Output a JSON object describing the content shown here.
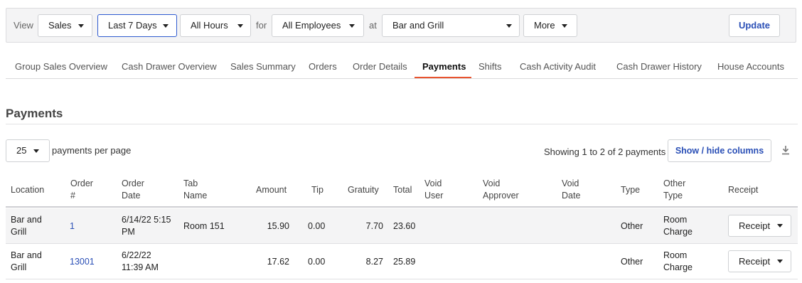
{
  "filters": {
    "view_label": "View",
    "view_value": "Sales",
    "range_value": "Last 7 Days",
    "hours_value": "All Hours",
    "for_label": "for",
    "employees_value": "All Employees",
    "at_label": "at",
    "location_value": "Bar and Grill",
    "more_label": "More",
    "update_label": "Update"
  },
  "tabs": [
    {
      "label": "Group Sales Overview"
    },
    {
      "label": "Cash Drawer Overview"
    },
    {
      "label": "Sales Summary"
    },
    {
      "label": "Orders"
    },
    {
      "label": "Order Details"
    },
    {
      "label": "Payments",
      "active": true
    },
    {
      "label": "Shifts"
    },
    {
      "label": "Cash Activity Audit"
    },
    {
      "label": "Cash Drawer History"
    },
    {
      "label": "House Accounts"
    }
  ],
  "section": {
    "title": "Payments",
    "per_page_value": "25",
    "per_page_label": "payments per page",
    "showing_text": "Showing 1 to 2 of 2 payments",
    "columns_button": "Show / hide columns",
    "download_icon": "download-icon"
  },
  "table": {
    "headers": {
      "location": "Location",
      "order_num_1": "Order",
      "order_num_2": "#",
      "order_date_1": "Order",
      "order_date_2": "Date",
      "tab_name_1": "Tab",
      "tab_name_2": "Name",
      "amount": "Amount",
      "tip": "Tip",
      "gratuity": "Gratuity",
      "total": "Total",
      "void_user_1": "Void",
      "void_user_2": "User",
      "void_approver_1": "Void",
      "void_approver_2": "Approver",
      "void_date_1": "Void",
      "void_date_2": "Date",
      "type": "Type",
      "other_type_1": "Other",
      "other_type_2": "Type",
      "receipt": "Receipt"
    },
    "rows": [
      {
        "location_1": "Bar and",
        "location_2": "Grill",
        "order_num": "1",
        "order_date_1": "6/14/22 5:15",
        "order_date_2": "PM",
        "tab_name": "Room 151",
        "amount": "15.90",
        "tip": "0.00",
        "gratuity": "7.70",
        "total": "23.60",
        "type": "Other",
        "other_type_1": "Room",
        "other_type_2": "Charge",
        "receipt_label": "Receipt"
      },
      {
        "location_1": "Bar and",
        "location_2": "Grill",
        "order_num": "13001",
        "order_date_1": "6/22/22",
        "order_date_2": "11:39 AM",
        "tab_name": "",
        "amount": "17.62",
        "tip": "0.00",
        "gratuity": "8.27",
        "total": "25.89",
        "type": "Other",
        "other_type_1": "Room",
        "other_type_2": "Charge",
        "receipt_label": "Receipt"
      }
    ]
  },
  "colors": {
    "accent": "#e8542f",
    "link": "#2a4fb6",
    "filter_bg": "#f4f4f5"
  }
}
